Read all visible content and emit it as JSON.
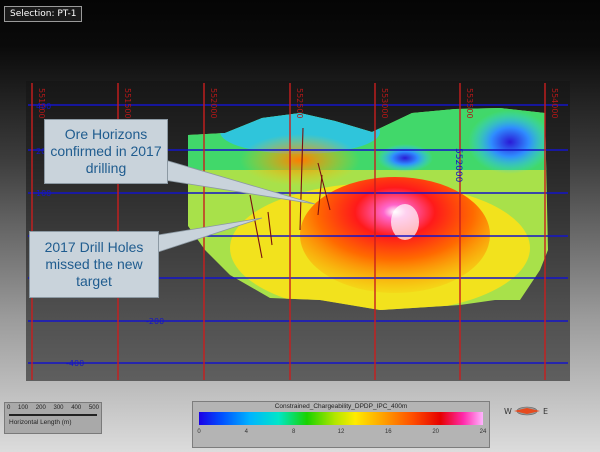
{
  "tab": {
    "label": "Selection: PT-1"
  },
  "section": {
    "easting_labels": [
      "551000",
      "551500",
      "552000",
      "552500",
      "553000",
      "553500",
      "554000"
    ],
    "elevation_labels": [
      "400",
      "200",
      "100",
      "0",
      "-200",
      "-400"
    ],
    "inline_label": "552000"
  },
  "callouts": {
    "ore": "Ore Horizons confirmed in 2017 drilling",
    "drill": "2017 Drill Holes missed the new target"
  },
  "scale": {
    "ticks": [
      "0",
      "100",
      "200",
      "300",
      "400",
      "500"
    ],
    "label": "Horizontal Length (m)"
  },
  "legend": {
    "title": "Constrained_Chargeability_DPDP_IPC_400m",
    "ticks": [
      "0",
      "4",
      "8",
      "12",
      "16",
      "20",
      "24"
    ]
  },
  "compass": {
    "west": "W",
    "east": "E",
    "needle_color": "#e64a1e"
  }
}
